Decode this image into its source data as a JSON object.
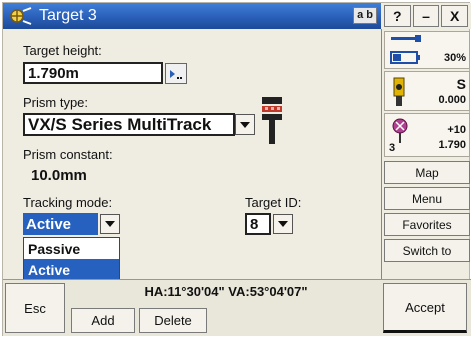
{
  "window": {
    "title": "Target 3",
    "input_mode": "a b",
    "help_label": "?",
    "minimize_label": "–",
    "close_label": "X"
  },
  "form": {
    "target_height": {
      "label": "Target height:",
      "value": "1.790m"
    },
    "prism_type": {
      "label": "Prism type:",
      "value": "VX/S Series MultiTrack"
    },
    "prism_constant": {
      "label": "Prism constant:",
      "value": "10.0mm"
    },
    "tracking_mode": {
      "label": "Tracking mode:",
      "value": "Active",
      "options": [
        "Passive",
        "Active"
      ],
      "selected_index": 1
    },
    "target_id": {
      "label": "Target ID:",
      "value": "8"
    }
  },
  "status": {
    "battery_percent_label": "30%",
    "instrument_letter": "S",
    "instrument_value": "0.000",
    "target_number": "3",
    "target_offset": "+10",
    "target_height": "1.790"
  },
  "sidebar_buttons": [
    "Map",
    "Menu",
    "Favorites",
    "Switch to"
  ],
  "bottom": {
    "angles": "HA:11°30'04\"  VA:53°04'07\"",
    "esc_label": "Esc",
    "add_label": "Add",
    "delete_label": "Delete",
    "accept_label": "Accept"
  },
  "colors": {
    "title_bar": "#2a5fb8",
    "selection": "#2761bf",
    "panel": "#efece2"
  },
  "icons": [
    "target-prism-icon",
    "keyboard-icon",
    "prism-device-icon",
    "battery-icon",
    "instrument-icon",
    "target-icon"
  ]
}
